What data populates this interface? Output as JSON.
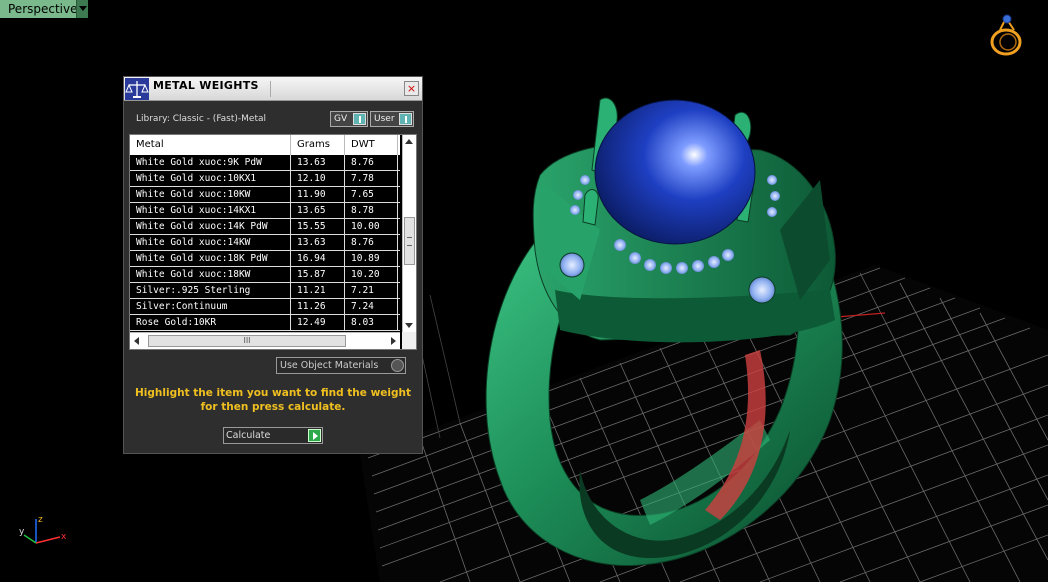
{
  "viewport": {
    "view_label": "Perspective",
    "gizmo": {
      "z": "z",
      "y": "y",
      "x": "x"
    }
  },
  "dialog": {
    "title": "METAL WEIGHTS",
    "close": "×",
    "library": "Library: Classic - (Fast)-Metal",
    "toggles": {
      "gv": "GV",
      "user": "User"
    },
    "table": {
      "columns": [
        "Metal",
        "Grams",
        "DWT"
      ],
      "rows": [
        [
          "White Gold xuoc:9K PdW",
          "13.63",
          "8.76"
        ],
        [
          "White Gold xuoc:10KX1",
          "12.10",
          "7.78"
        ],
        [
          "White Gold xuoc:10KW",
          "11.90",
          "7.65"
        ],
        [
          "White Gold xuoc:14KX1",
          "13.65",
          "8.78"
        ],
        [
          "White Gold xuoc:14K PdW",
          "15.55",
          "10.00"
        ],
        [
          "White Gold xuoc:14KW",
          "13.63",
          "8.76"
        ],
        [
          "White Gold xuoc:18K PdW",
          "16.94",
          "10.89"
        ],
        [
          "White Gold xuoc:18KW",
          "15.87",
          "10.20"
        ],
        [
          "Silver:.925 Sterling",
          "11.21",
          "7.21"
        ],
        [
          "Silver:Continuum",
          "11.26",
          "7.24"
        ],
        [
          "Rose Gold:10KR",
          "12.49",
          "8.03"
        ]
      ],
      "hscroll_grip": "III"
    },
    "use_object_materials": "Use Object Materials",
    "hint": "Highlight the item you want to find the weight for then press calculate.",
    "calculate": "Calculate"
  },
  "colors": {
    "ring": "#1f8f5a",
    "gem": "#1a3fb8",
    "hint": "#f0c020",
    "view_label_bg": "#7ab98c"
  }
}
